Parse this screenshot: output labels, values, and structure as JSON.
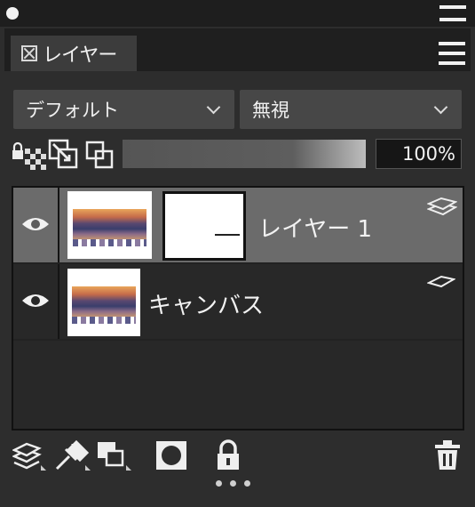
{
  "panel": {
    "tab_label": "レイヤー",
    "blend_mode": "デフォルト",
    "composite_mode": "無視",
    "opacity_percent": "100%",
    "opacity_value": 100
  },
  "layers": [
    {
      "name": "レイヤー 1",
      "visible": true,
      "selected": true,
      "has_mask": true
    },
    {
      "name": "キャンバス",
      "visible": true,
      "selected": false,
      "has_mask": false
    }
  ],
  "icons": {
    "panel_menu": "hamburger-icon",
    "lock_transparency": "lock-transparency-icon",
    "clip": "clip-icon",
    "reference": "reference-layer-icon",
    "new_layer": "new-layer-icon",
    "new_adjustment": "adjustment-layer-icon",
    "new_folder": "layer-set-icon",
    "mask": "add-mask-icon",
    "lock": "lock-icon",
    "delete": "trash-icon",
    "more": "more-icon"
  }
}
